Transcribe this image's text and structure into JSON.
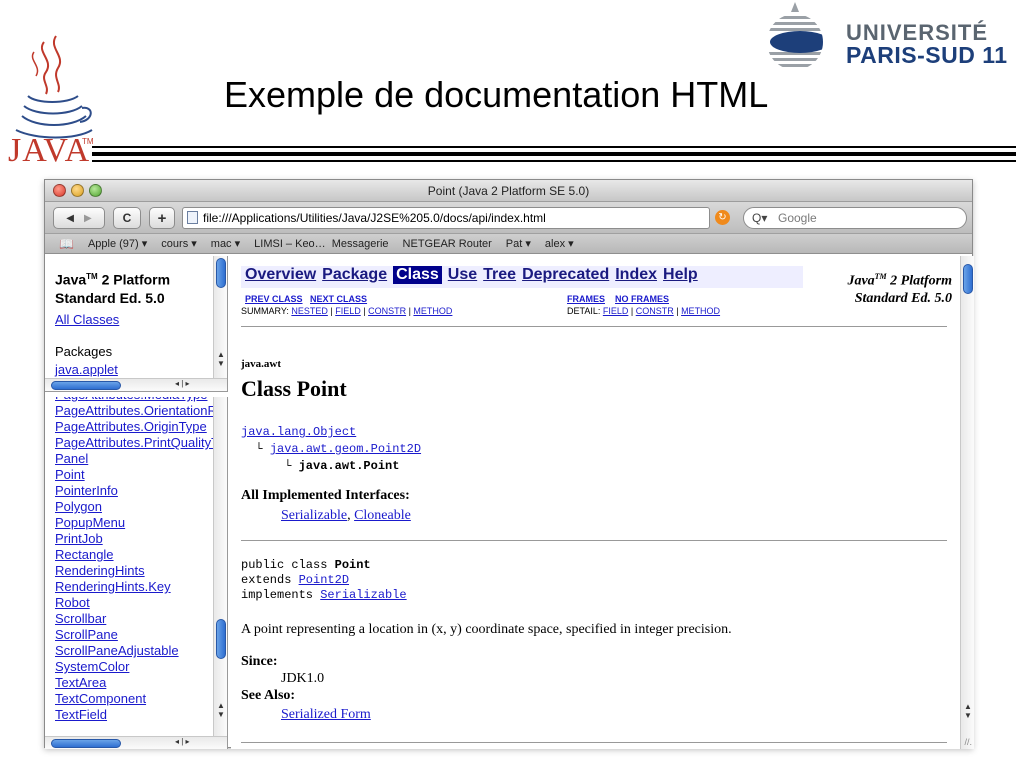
{
  "slide": {
    "title": "Exemple de documentation HTML",
    "java_logo_text": "JAVA",
    "java_tm": "TM",
    "university_line1": "UNIVERSITÉ",
    "university_line2": "PARIS-SUD 11"
  },
  "window": {
    "title": "Point (Java 2 Platform SE 5.0)"
  },
  "toolbar": {
    "back_label": "◀",
    "forward_label": "▶",
    "reload_label": "C",
    "add_label": "+",
    "url": "file:///Applications/Utilities/Java/J2SE%205.0/docs/api/index.html",
    "search_placeholder": "Google"
  },
  "bookmarks": [
    "Apple (97) ▾",
    "cours ▾",
    "mac ▾",
    "LIMSI – Keo…",
    "Messagerie",
    "NETGEAR Router",
    "Pat ▾",
    "alex ▾"
  ],
  "left_top": {
    "heading_line1": "Java",
    "heading_tm": "TM",
    "heading_line1_rest": " 2 Platform",
    "heading_line2": "Standard Ed. 5.0",
    "all_classes": "All Classes",
    "packages_label": "Packages",
    "first_package": "java.applet"
  },
  "class_list": [
    "PageAttributes.MediaType",
    "PageAttributes.OrientationRequestedType",
    "PageAttributes.OriginType",
    "PageAttributes.PrintQualityType",
    "Panel",
    "Point",
    "PointerInfo",
    "Polygon",
    "PopupMenu",
    "PrintJob",
    "Rectangle",
    "RenderingHints",
    "RenderingHints.Key",
    "Robot",
    "Scrollbar",
    "ScrollPane",
    "ScrollPaneAdjustable",
    "SystemColor",
    "TextArea",
    "TextComponent",
    "TextField"
  ],
  "nav": {
    "items": [
      "Overview",
      "Package",
      "Class",
      "Use",
      "Tree",
      "Deprecated",
      "Index",
      "Help"
    ],
    "active": "Class",
    "right_line1": "Java",
    "right_tm": "TM",
    "right_line1_rest": " 2 Platform",
    "right_line2": "Standard Ed. 5.0",
    "prev_class": "PREV CLASS",
    "next_class": "NEXT CLASS",
    "frames": "FRAMES",
    "no_frames": "NO FRAMES",
    "summary_label": "SUMMARY:",
    "summary_links": [
      "NESTED",
      "FIELD",
      "CONSTR",
      "METHOD"
    ],
    "detail_label": "DETAIL:",
    "detail_links": [
      "FIELD",
      "CONSTR",
      "METHOD"
    ]
  },
  "doc": {
    "package": "java.awt",
    "class_title": "Class Point",
    "hier_root": "java.lang.Object",
    "hier_mid": "java.awt.geom.Point2D",
    "hier_leaf": "java.awt.Point",
    "impl_heading": "All Implemented Interfaces:",
    "impl_1": "Serializable",
    "impl_2": "Cloneable",
    "decl_line1_pre": "public class ",
    "decl_line1_cls": "Point",
    "decl_line2_pre": "extends ",
    "decl_line2_lnk": "Point2D",
    "decl_line3_pre": "implements ",
    "decl_line3_lnk": "Serializable",
    "description": "A point representing a location in (x, y) coordinate space, specified in integer precision.",
    "since_heading": "Since:",
    "since_value": "JDK1.0",
    "see_heading": "See Also:",
    "see_value": "Serialized Form"
  }
}
